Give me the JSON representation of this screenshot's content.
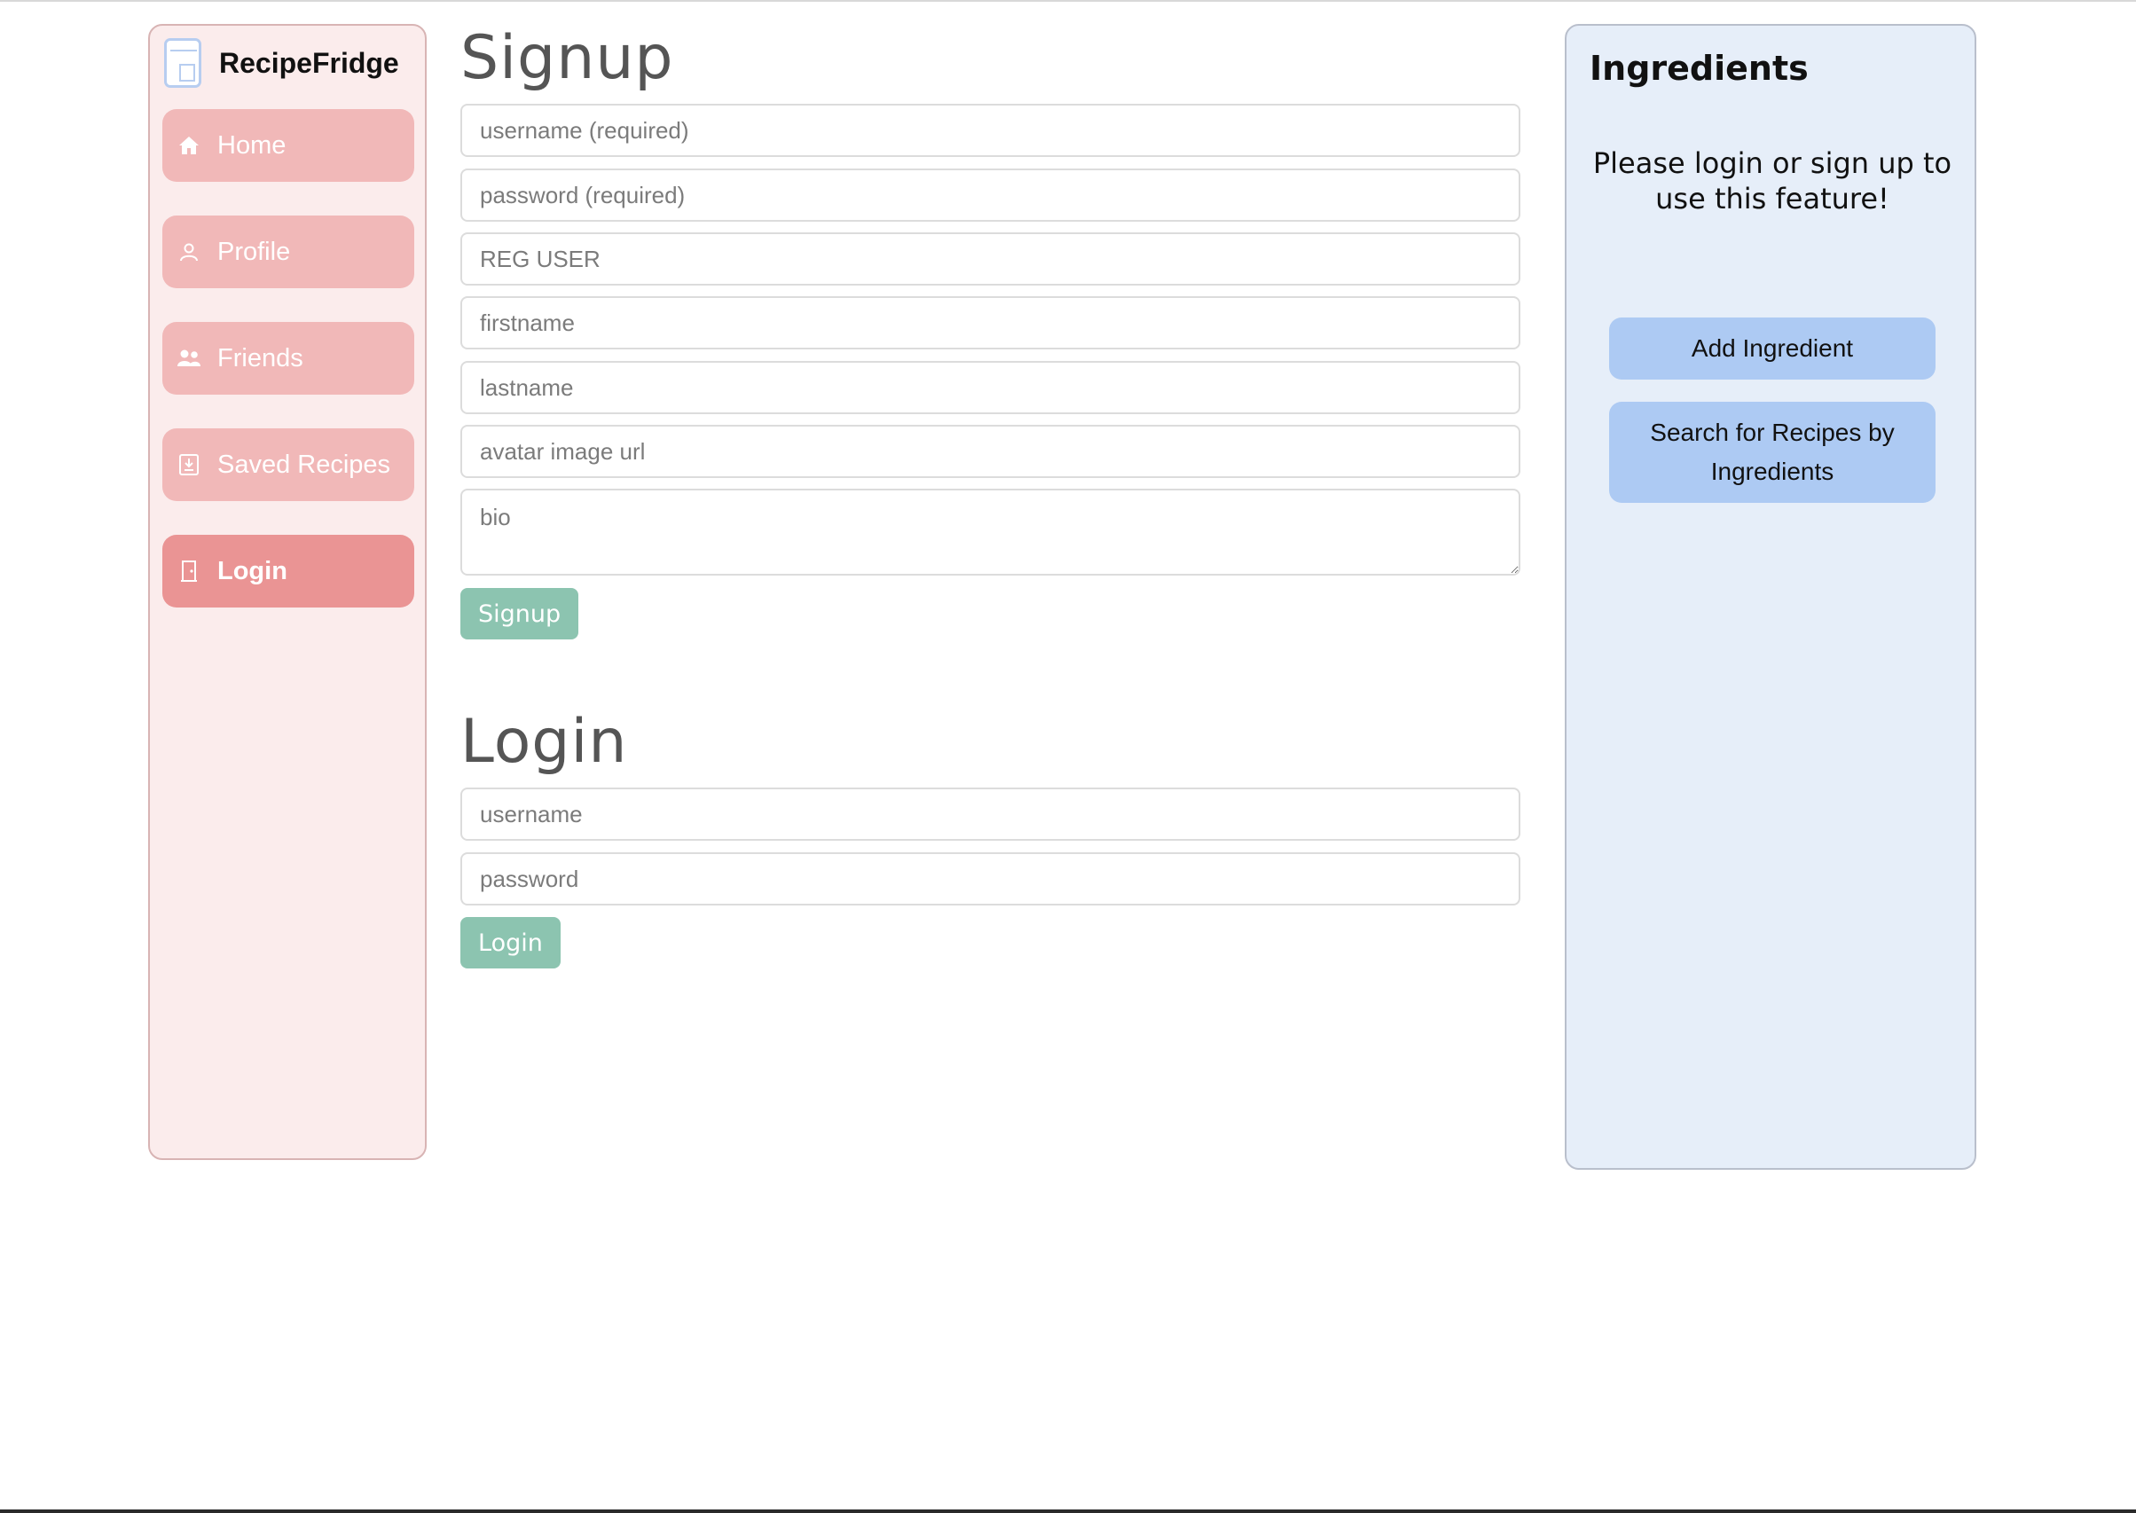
{
  "brand": {
    "name": "RecipeFridge",
    "logo_icon": "fridge-icon"
  },
  "sidebar": {
    "items": [
      {
        "label": "Home",
        "icon": "home-icon"
      },
      {
        "label": "Profile",
        "icon": "user-icon"
      },
      {
        "label": "Friends",
        "icon": "users-icon"
      },
      {
        "label": "Saved Recipes",
        "icon": "download-icon"
      },
      {
        "label": "Login",
        "icon": "door-icon",
        "active": true
      }
    ]
  },
  "signup": {
    "title": "Signup",
    "username_placeholder": "username (required)",
    "password_placeholder": "password (required)",
    "role_value": "REG USER",
    "firstname_placeholder": "firstname",
    "lastname_placeholder": "lastname",
    "avatar_placeholder": "avatar image url",
    "bio_placeholder": "bio",
    "submit_label": "Signup"
  },
  "login": {
    "title": "Login",
    "username_placeholder": "username",
    "password_placeholder": "password",
    "submit_label": "Login"
  },
  "ingredients": {
    "title": "Ingredients",
    "message": "Please login or sign up to use this feature!",
    "add_label": "Add Ingredient",
    "search_label": "Search for Recipes by Ingredients"
  },
  "colors": {
    "sidebar_bg": "#fbecec",
    "nav_item": "#f1b8b8",
    "nav_active": "#ea9494",
    "green_button": "#8cc4b0",
    "panel_bg": "#e6eef9",
    "blue_button": "#adcaf3"
  }
}
